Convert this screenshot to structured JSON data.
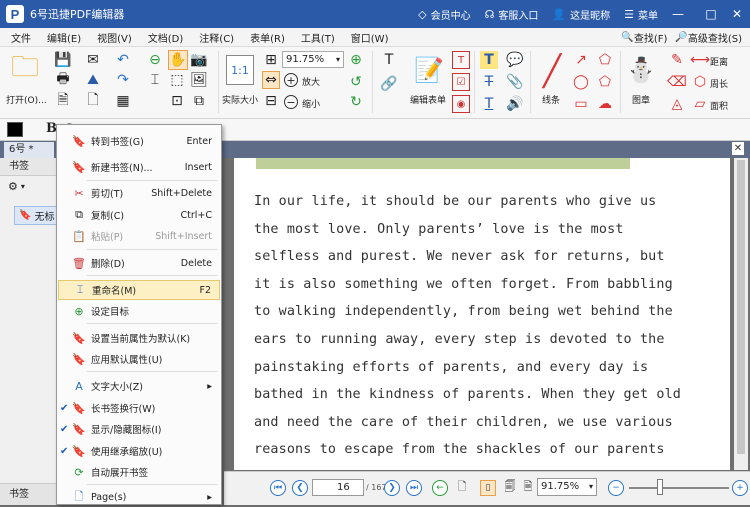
{
  "window": {
    "app_logo": "P",
    "title": "6号迅捷PDF编辑器",
    "member": "会员中心",
    "support": "客服入口",
    "user": "这是昵称",
    "menu": "菜单",
    "min": "—",
    "max": "□",
    "close": "✕"
  },
  "menubar": {
    "items": [
      "文件",
      "编辑(E)",
      "视图(V)",
      "文档(D)",
      "注释(C)",
      "表单(R)",
      "工具(T)",
      "窗口(W)"
    ],
    "find": "查找(F)",
    "adv_find": "高级查找(S)"
  },
  "toolbar": {
    "open": "打开(O)...",
    "actual_size": "实际大小",
    "zoom_value": "91.75%",
    "zoom_in": "放大",
    "zoom_out": "缩小",
    "edit_form": "编辑表单",
    "line": "线条",
    "stamp": "图章",
    "distance": "距离",
    "perimeter": "周长",
    "area": "面积"
  },
  "format": {
    "bold": "B",
    "italic": "I"
  },
  "doc_tab": {
    "name": "6号 *"
  },
  "sidebar": {
    "title": "书签",
    "node": "无标",
    "footer": "书签"
  },
  "context_menu": [
    {
      "label": "转到书签(G)",
      "shortcut": "Enter",
      "icon": "goto-bookmark-icon"
    },
    {
      "label": "新建书签(N)...",
      "shortcut": "Insert",
      "icon": "new-bookmark-icon"
    },
    {
      "label": "剪切(T)",
      "shortcut": "Shift+Delete",
      "icon": "scissors-icon"
    },
    {
      "label": "复制(C)",
      "shortcut": "Ctrl+C",
      "icon": "copy-icon"
    },
    {
      "label": "粘贴(P)",
      "shortcut": "Shift+Insert",
      "icon": "paste-icon",
      "disabled": true
    },
    {
      "label": "删除(D)",
      "shortcut": "Delete",
      "icon": "trash-icon"
    },
    {
      "label": "重命名(M)",
      "shortcut": "F2",
      "icon": "rename-icon",
      "highlighted": true
    },
    {
      "label": "设定目标",
      "shortcut": "",
      "icon": "set-target-icon"
    },
    {
      "label": "设置当前属性为默认(K)",
      "shortcut": "",
      "icon": "set-default-icon"
    },
    {
      "label": "应用默认属性(U)",
      "shortcut": "",
      "icon": "apply-default-icon"
    },
    {
      "label": "文字大小(Z)",
      "shortcut": "▸",
      "icon": "text-size-icon"
    },
    {
      "label": "长书签换行(W)",
      "shortcut": "",
      "icon": "wrap-icon",
      "checked": true
    },
    {
      "label": "显示/隐藏图标(I)",
      "shortcut": "",
      "icon": "show-icons-icon",
      "checked": true
    },
    {
      "label": "使用继承缩放(U)",
      "shortcut": "",
      "icon": "inherit-zoom-icon",
      "checked": true
    },
    {
      "label": "自动展开书签",
      "shortcut": "",
      "icon": "auto-expand-icon"
    },
    {
      "label": "Page(s)",
      "shortcut": "▸",
      "icon": "pages-icon"
    }
  ],
  "document": {
    "lines": [
      "In our life, it should be our parents who give us",
      "the most love. Only parents’ love is the most",
      "selfless and purest. We never ask for returns, but",
      "it is also something we often forget. From babbling",
      "to walking independently, from being wet behind the",
      "ears to running away, every step is devoted to the",
      "painstaking efforts of parents, and every day is",
      "bathed in the kindness of parents. When they get old",
      "and need the care of their children, we use various",
      "reasons to escape from the shackles of our parents"
    ]
  },
  "statusbar": {
    "page": "16",
    "total": "/ 167",
    "zoom": "91.75%"
  },
  "colors": {
    "titlebar": "#2b5aa8",
    "accent": "#2a74c8",
    "highlight": "#fdf0c4"
  }
}
